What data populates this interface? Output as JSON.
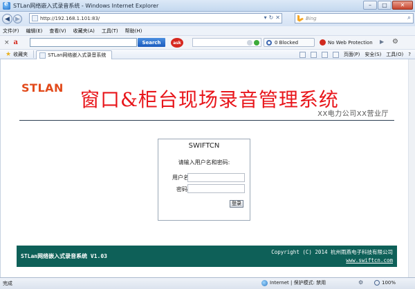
{
  "window": {
    "title": "STLan网络嵌入式录音系统 - Windows Internet Explorer",
    "controls": [
      "–",
      "□",
      "✕"
    ]
  },
  "address": {
    "url": "http://192.168.1.101:83/",
    "search_placeholder": "Bing"
  },
  "menu": [
    "文件(F)",
    "编辑(E)",
    "查看(V)",
    "收藏夹(A)",
    "工具(T)",
    "帮助(H)"
  ],
  "toolbar": {
    "search_button": "Search",
    "badge": "ask",
    "blocked": "0 Blocked",
    "no_web_protection": "No Web Protection"
  },
  "favorites": {
    "label": "收藏夹",
    "tab_title": "STLan网络嵌入式录音系统",
    "commands": [
      "页面(P)",
      "安全(S)",
      "工具(O)"
    ]
  },
  "page": {
    "logo": "STLAN",
    "title": "窗口&柜台现场录音管理系统",
    "subtitle": "XX电力公司XX营业厅",
    "login": {
      "heading": "SWIFTCN",
      "prompt": "请输入用户名和密码:",
      "username_label": "用户名",
      "password_label": "密码",
      "username_value": "",
      "password_value": "",
      "submit": "登录"
    },
    "footer": {
      "product": "STLan网络嵌入式录音系统 V1.03",
      "copyright": "Copyright (C) 2014 杭州雨燕电子科技有限公司",
      "website": "www.swiftcn.com"
    }
  },
  "status": {
    "text": "完成",
    "zone": "Internet | 保护模式: 禁用",
    "zoom": "100%"
  }
}
